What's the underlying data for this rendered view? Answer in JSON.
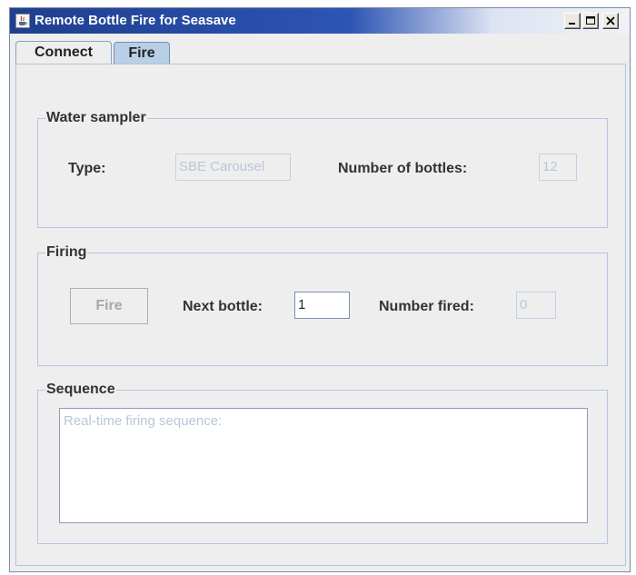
{
  "window": {
    "title": "Remote Bottle Fire for Seasave",
    "controls": [
      "minimize",
      "maximize",
      "close"
    ]
  },
  "tabs": [
    {
      "label": "Connect",
      "selected": false
    },
    {
      "label": "Fire",
      "selected": true
    }
  ],
  "water_sampler": {
    "group_label": "Water sampler",
    "type_label": "Type:",
    "type_value": "SBE Carousel",
    "bottles_label": "Number of bottles:",
    "bottles_value": "12"
  },
  "firing": {
    "group_label": "Firing",
    "fire_button": "Fire",
    "next_bottle_label": "Next bottle:",
    "next_bottle_value": "1",
    "number_fired_label": "Number fired:",
    "number_fired_value": "0"
  },
  "sequence": {
    "group_label": "Sequence",
    "placeholder": "Real-time firing sequence:"
  },
  "colors": {
    "titlebar": "#2d55b4",
    "selected_tab": "#b8cfe5",
    "disabled_text": "#b9c6da"
  }
}
